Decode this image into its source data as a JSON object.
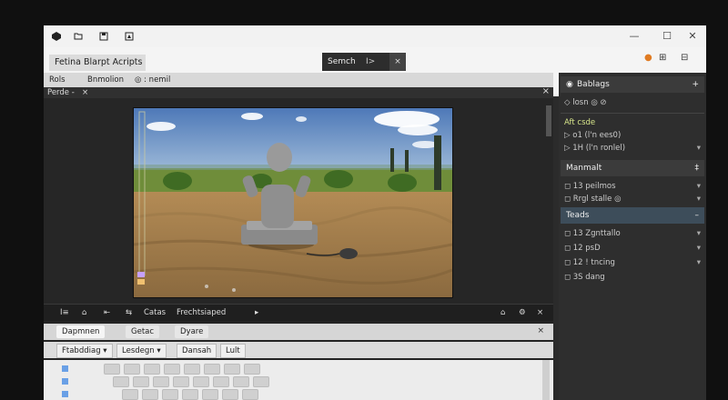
{
  "window": {
    "title_icons": [
      "unity-logo-icon",
      "folder-icon",
      "save-icon",
      "build-icon"
    ],
    "controls": [
      "minimize-button",
      "maximize-button",
      "close-button"
    ]
  },
  "menubar": {
    "app_title": "Fetina Blarpt Acripts",
    "center_tab_label": "Semch",
    "center_tab_arrow": "I>",
    "center_tab_close": "×",
    "sub_items": [
      "Rols",
      "Bnmolion",
      "◎ : nemil"
    ]
  },
  "scene": {
    "tab_label": "Perde -",
    "close_label": "×"
  },
  "inspector": {
    "header": "Bablags",
    "header_plus": "+",
    "header2": "Manmalt",
    "header2_plus": "‡",
    "teads_label": "Teads",
    "teads_sep": "–",
    "rows_top": [
      {
        "label": "◇ losn ◎ ⊘",
        "dd": ""
      },
      {
        "label": "Aft csde",
        "dd": ""
      },
      {
        "label": "▷ o1 (l'n ees0)",
        "dd": ""
      },
      {
        "label": "▷ 1H (l'n ronlel)",
        "dd": "▾"
      }
    ],
    "rows_mid": [
      {
        "label": "◻ 13 peilmos",
        "dd": "▾"
      },
      {
        "label": "◻ Rrgl stalle ◎",
        "dd": "▾"
      }
    ],
    "rows_bottom": [
      {
        "label": "◻ 13 Zgnttallo",
        "dd": "▾"
      },
      {
        "label": "◻ 12 psD",
        "dd": "▾"
      },
      {
        "label": "◻ 12 ! tncing",
        "dd": "▾"
      },
      {
        "label": "◻ 3S dang",
        "dd": ""
      }
    ]
  },
  "bottom": {
    "toolbar_items": [
      "I≡",
      "⌂",
      "⇤",
      "⇆",
      "Catas",
      "Frechtsiaped",
      "▸"
    ],
    "toolbar_right": [
      "⌂",
      "⚙",
      "×"
    ],
    "tabs": [
      "Dapmnen",
      "Getac",
      "Dyare"
    ],
    "filters": [
      "Ftabddiag ▾",
      "Lesdegn ▾",
      "Dansah",
      "Lult"
    ],
    "close": "×"
  }
}
